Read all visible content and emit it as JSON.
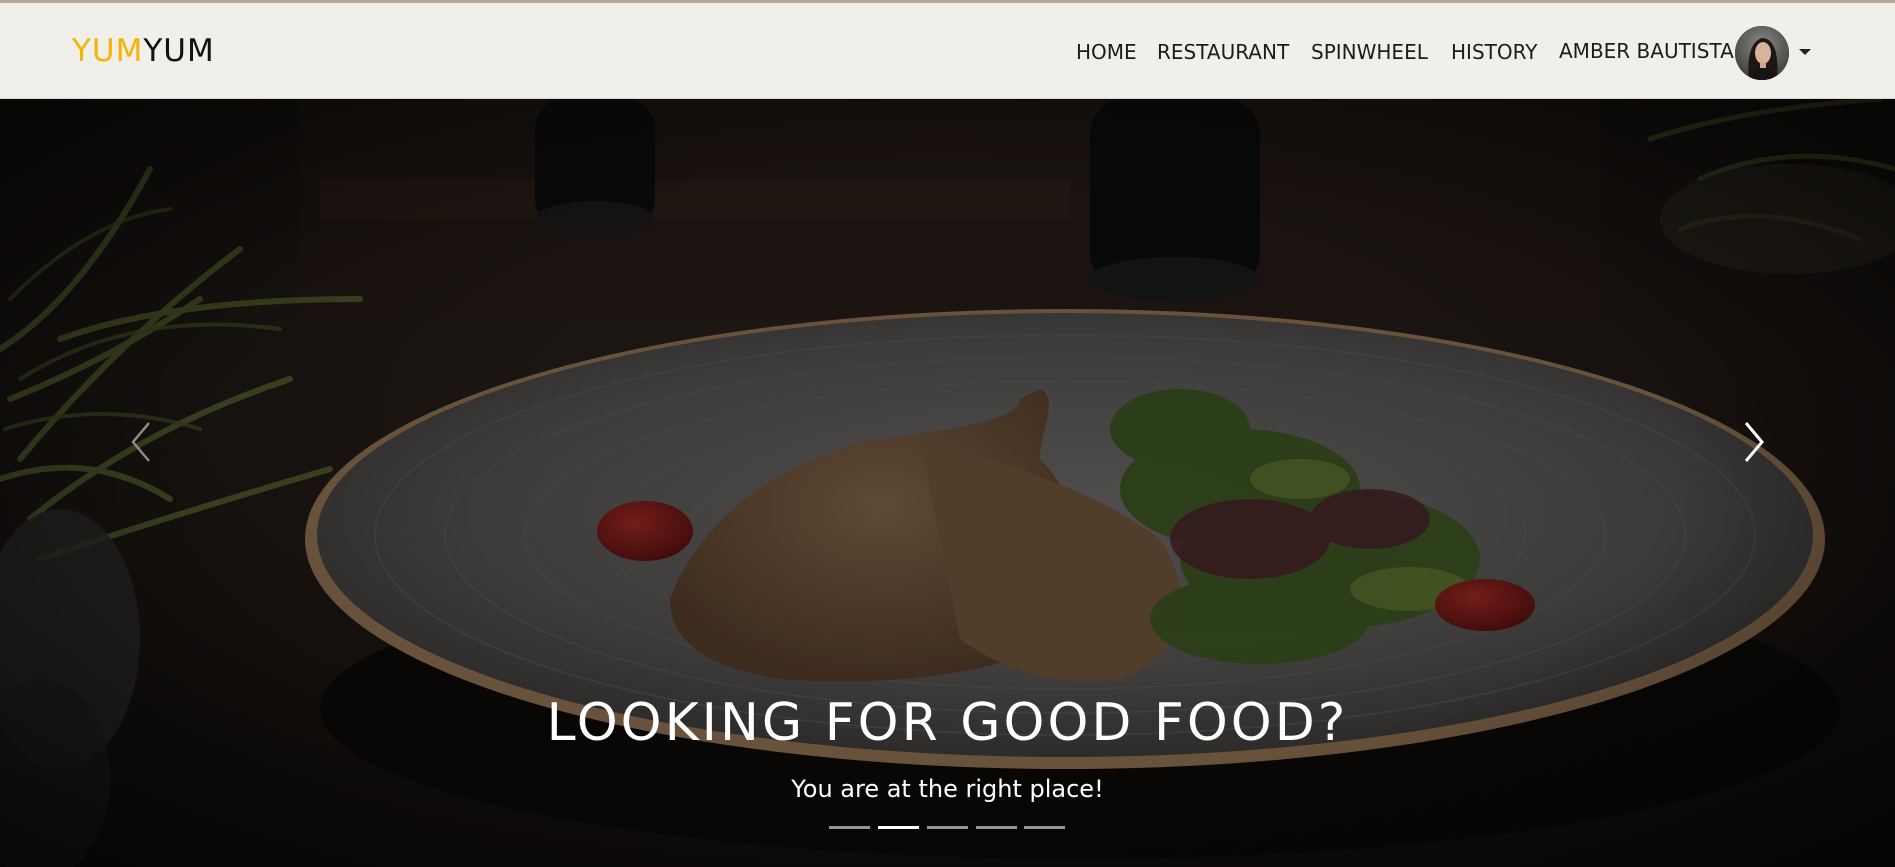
{
  "brand": {
    "part1": "YUM",
    "part2": "YUM"
  },
  "nav": {
    "items": [
      {
        "label": "HOME"
      },
      {
        "label": "RESTAURANT"
      },
      {
        "label": "SPINWHEEL"
      },
      {
        "label": "HISTORY"
      }
    ],
    "user": {
      "name": "AMBER BAUTISTA",
      "avatar_icon": "user-avatar",
      "caret_icon": "caret-down-icon"
    }
  },
  "hero": {
    "title": "LOOKING FOR GOOD FOOD?",
    "subtitle": "You are at the right place!",
    "prev_icon": "chevron-left-icon",
    "next_icon": "chevron-right-icon",
    "slide_count": 5,
    "active_slide": 2
  },
  "colors": {
    "brand_accent": "#f5b400",
    "navbar_bg": "#f0efea",
    "text_dark": "#1c1c1c",
    "caption_text": "#ffffff"
  }
}
